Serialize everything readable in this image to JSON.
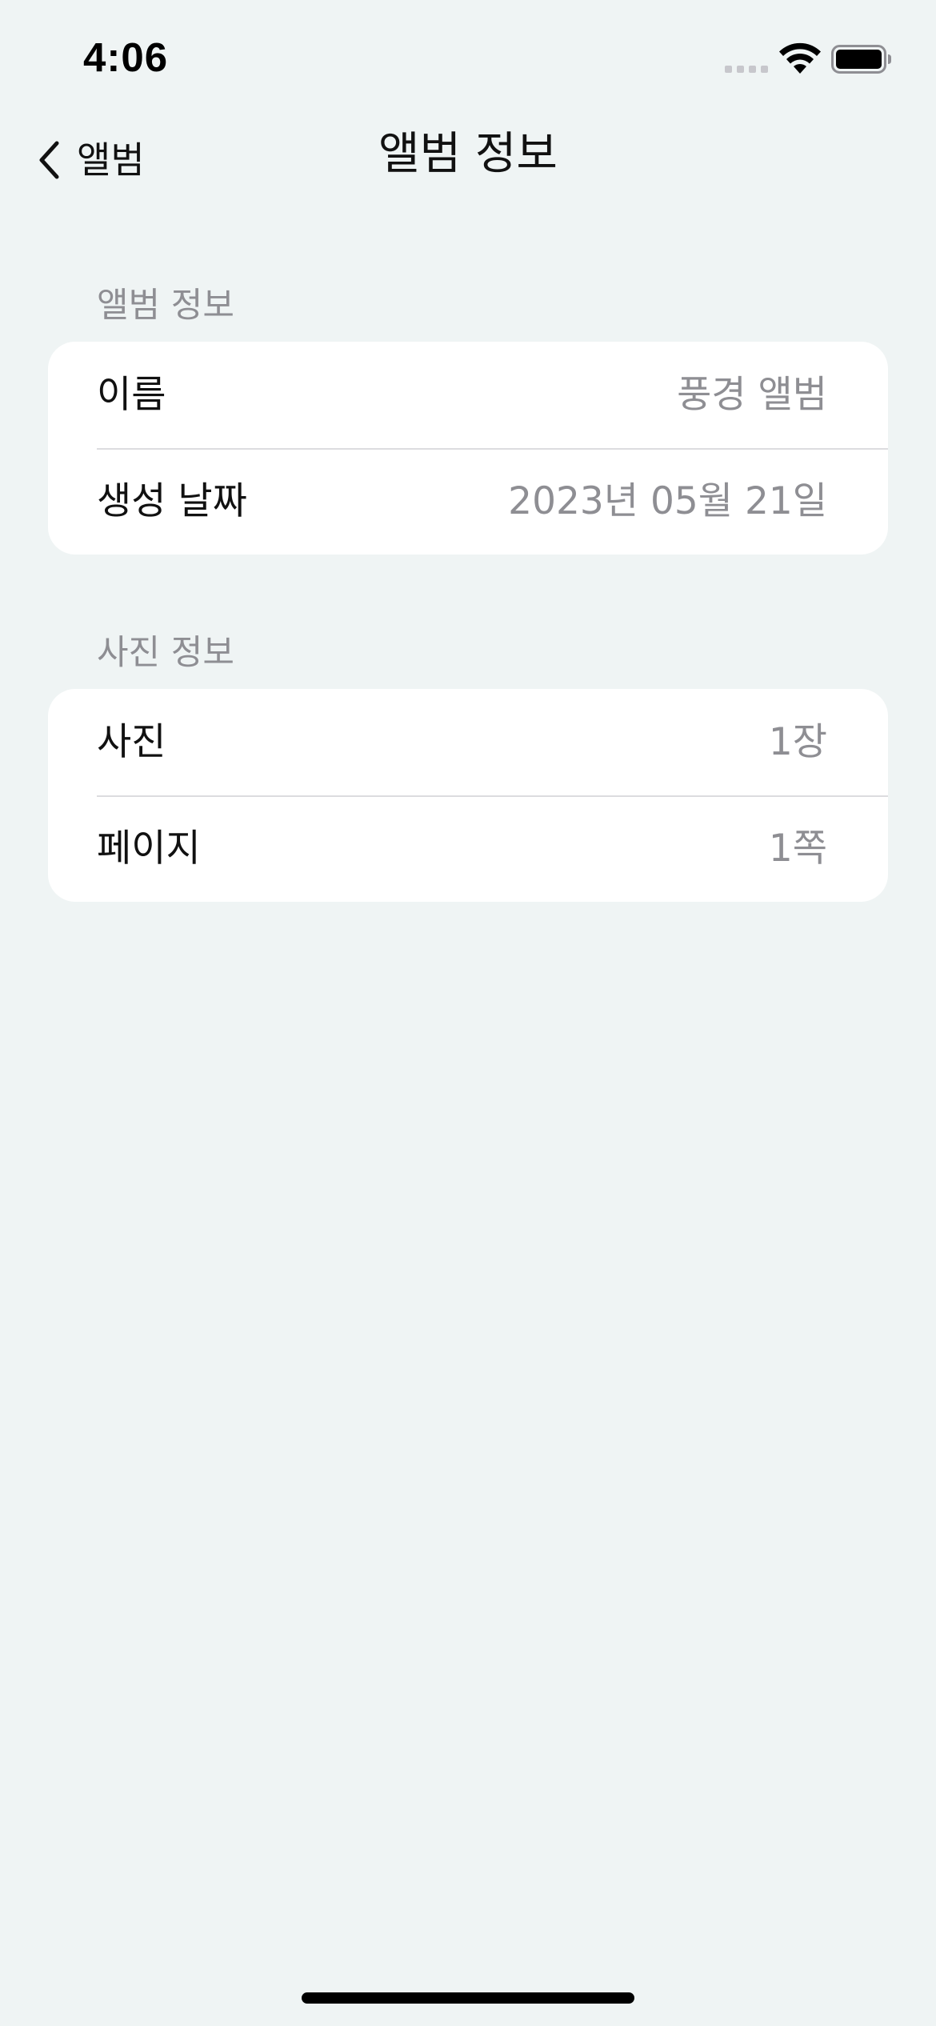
{
  "status_bar": {
    "time": "4:06"
  },
  "nav": {
    "back_label": "앨범",
    "title": "앨범 정보"
  },
  "sections": [
    {
      "header": "앨범 정보",
      "rows": [
        {
          "label": "이름",
          "value": "풍경 앨범"
        },
        {
          "label": "생성 날짜",
          "value": "2023년 05월 21일"
        }
      ]
    },
    {
      "header": "사진 정보",
      "rows": [
        {
          "label": "사진",
          "value": "1장"
        },
        {
          "label": "페이지",
          "value": "1쪽"
        }
      ]
    }
  ],
  "colors": {
    "background": "#EFF4F4",
    "card": "#FFFFFF",
    "secondary_text": "#8E8E93",
    "separator": "#DCDCDF"
  }
}
